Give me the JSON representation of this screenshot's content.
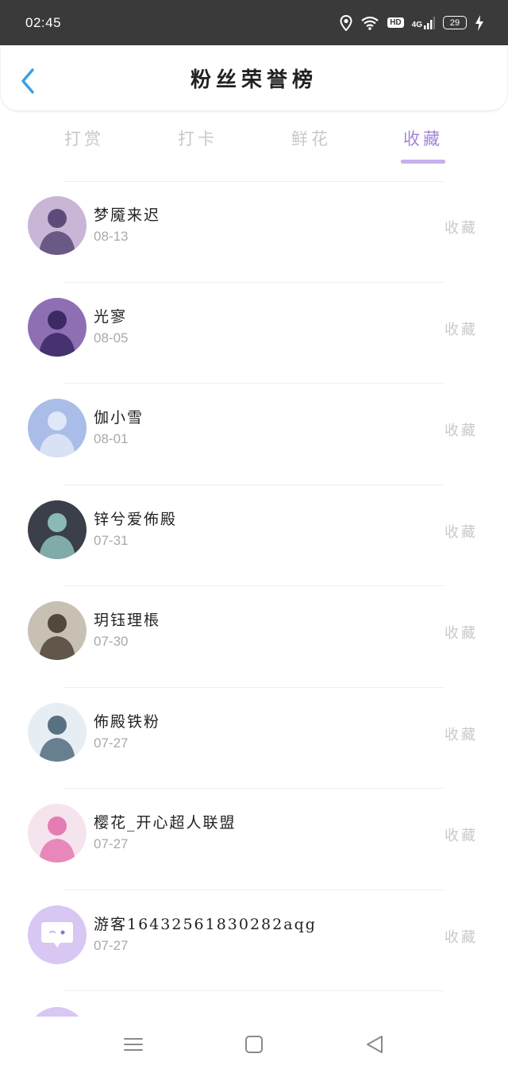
{
  "status_bar": {
    "time": "02:45",
    "hd_label": "HD",
    "network_label": "4G",
    "battery_level": "29"
  },
  "header": {
    "title": "粉丝荣誉榜"
  },
  "tabs": [
    {
      "label": "打赏",
      "active": false
    },
    {
      "label": "打卡",
      "active": false
    },
    {
      "label": "鲜花",
      "active": false
    },
    {
      "label": "收藏",
      "active": true
    }
  ],
  "fans": [
    {
      "name": "梦魇来迟",
      "date": "08-13",
      "action": "收藏",
      "avatar": {
        "bg": "#c9b6d6",
        "fg": "#4a3a6a"
      }
    },
    {
      "name": "光寥",
      "date": "08-05",
      "action": "收藏",
      "avatar": {
        "bg": "#8f6fb4",
        "fg": "#2e1e57"
      }
    },
    {
      "name": "伽小雪",
      "date": "08-01",
      "action": "收藏",
      "avatar": {
        "bg": "#a9bde8",
        "fg": "#e9eefa"
      }
    },
    {
      "name": "锌兮爱佈殿",
      "date": "07-31",
      "action": "收藏",
      "avatar": {
        "bg": "#3b3f4a",
        "fg": "#9ad0c8"
      }
    },
    {
      "name": "玥钰理棖",
      "date": "07-30",
      "action": "收藏",
      "avatar": {
        "bg": "#c9c0b4",
        "fg": "#3d3326"
      }
    },
    {
      "name": "佈殿铁粉",
      "date": "07-27",
      "action": "收藏",
      "avatar": {
        "bg": "#e6eef3",
        "fg": "#3e5a6e"
      }
    },
    {
      "name": "樱花_开心超人联盟",
      "date": "07-27",
      "action": "收藏",
      "avatar": {
        "bg": "#f5e4ee",
        "fg": "#e36aa8"
      }
    },
    {
      "name": "游客16432561830282aqg",
      "date": "07-27",
      "action": "收藏",
      "avatar": {
        "bg": "#d8c6f3",
        "fg": "#ffffff",
        "guest": true
      }
    }
  ],
  "colors": {
    "accent": "#a585d8",
    "underline": "#c6b1ec",
    "inactive_tab": "#c8c8c8",
    "back_arrow": "#3aa0e6"
  }
}
